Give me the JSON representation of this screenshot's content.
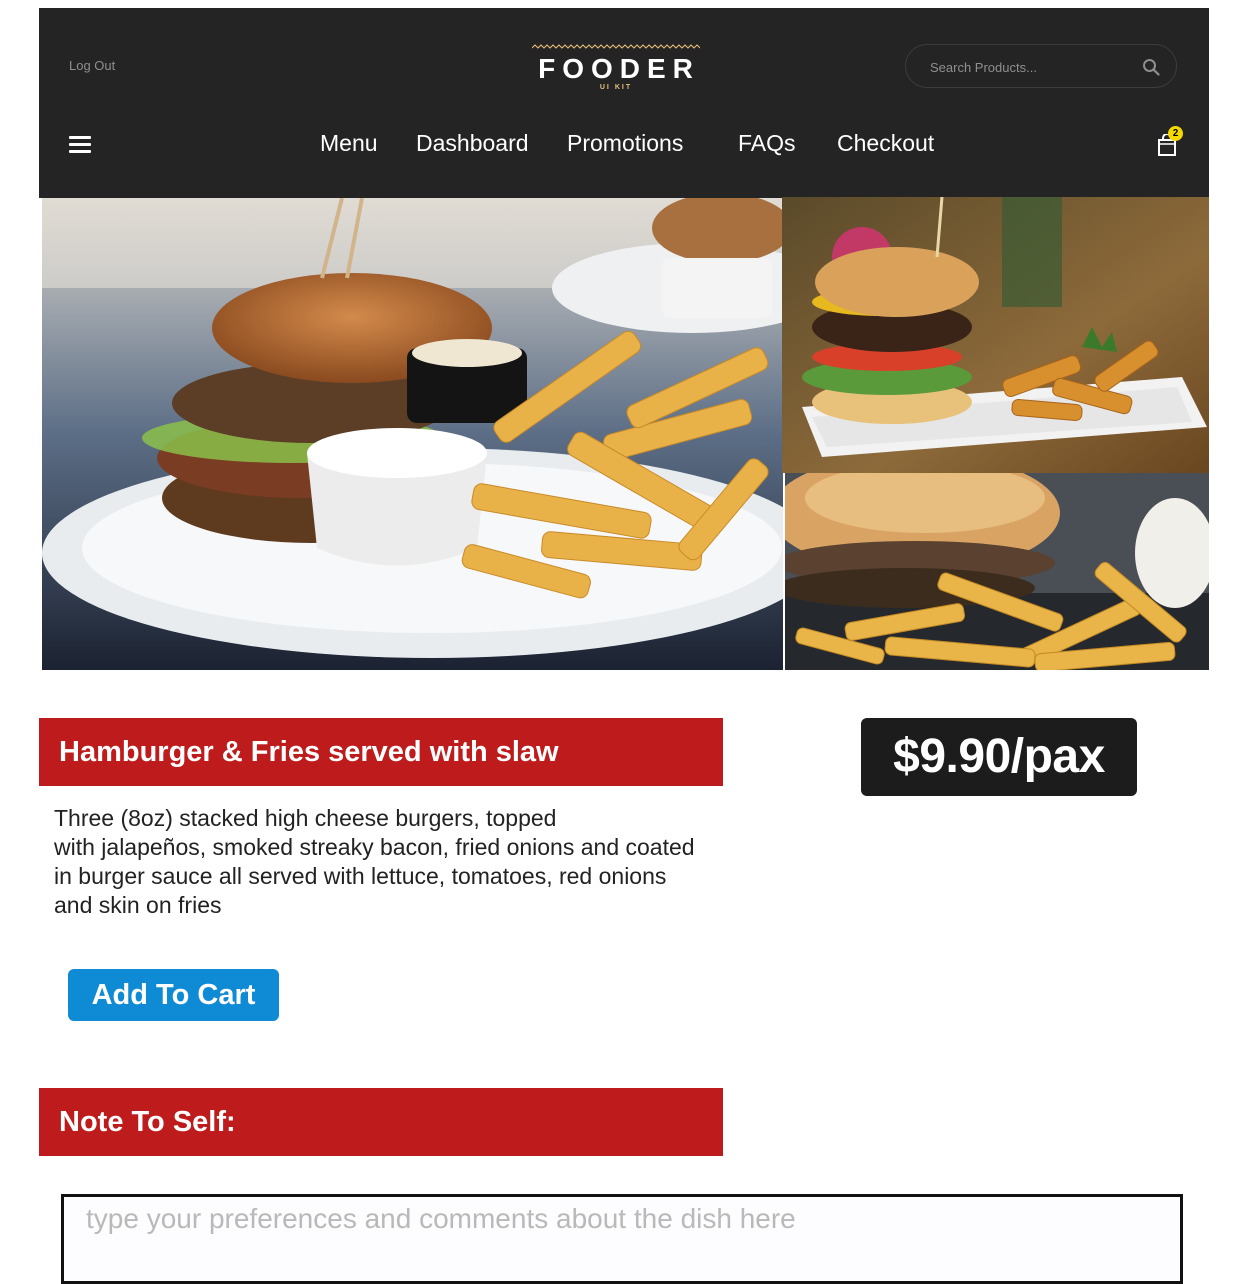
{
  "header": {
    "logout_label": "Log Out",
    "brand": "FOODER",
    "brand_sub": "UI KIT",
    "search_placeholder": "Search Products...",
    "nav": [
      "Menu",
      "Dashboard",
      "Promotions",
      "FAQs",
      "Checkout"
    ],
    "cart_count": "2"
  },
  "product": {
    "title": "Hamburger & Fries served with slaw",
    "price": "$9.90/pax",
    "description": "Three (8oz) stacked high cheese burgers, topped with jalapeños, smoked streaky bacon, fried onions and coated in burger sauce all served with lettuce, tomatoes, red onions and skin on fries",
    "description_lines": [
      "Three (8oz) stacked high cheese burgers, topped",
      "with jalapeños, smoked streaky bacon, fried onions and coated",
      "in burger sauce all served with lettuce, tomatoes, red onions",
      "and skin on fries"
    ],
    "add_to_cart_label": "Add To Cart"
  },
  "note": {
    "heading": "Note To Self:",
    "placeholder": "type your preferences and comments about the dish here"
  },
  "colors": {
    "header_bg": "#242424",
    "heading_red": "#be1c1c",
    "price_bg": "#1c1c1c",
    "button_blue": "#0f8ad5",
    "badge_yellow": "#f5d800",
    "logo_accent": "#e8c07a"
  },
  "icons": [
    "menu-icon",
    "search-icon",
    "cart-icon"
  ]
}
